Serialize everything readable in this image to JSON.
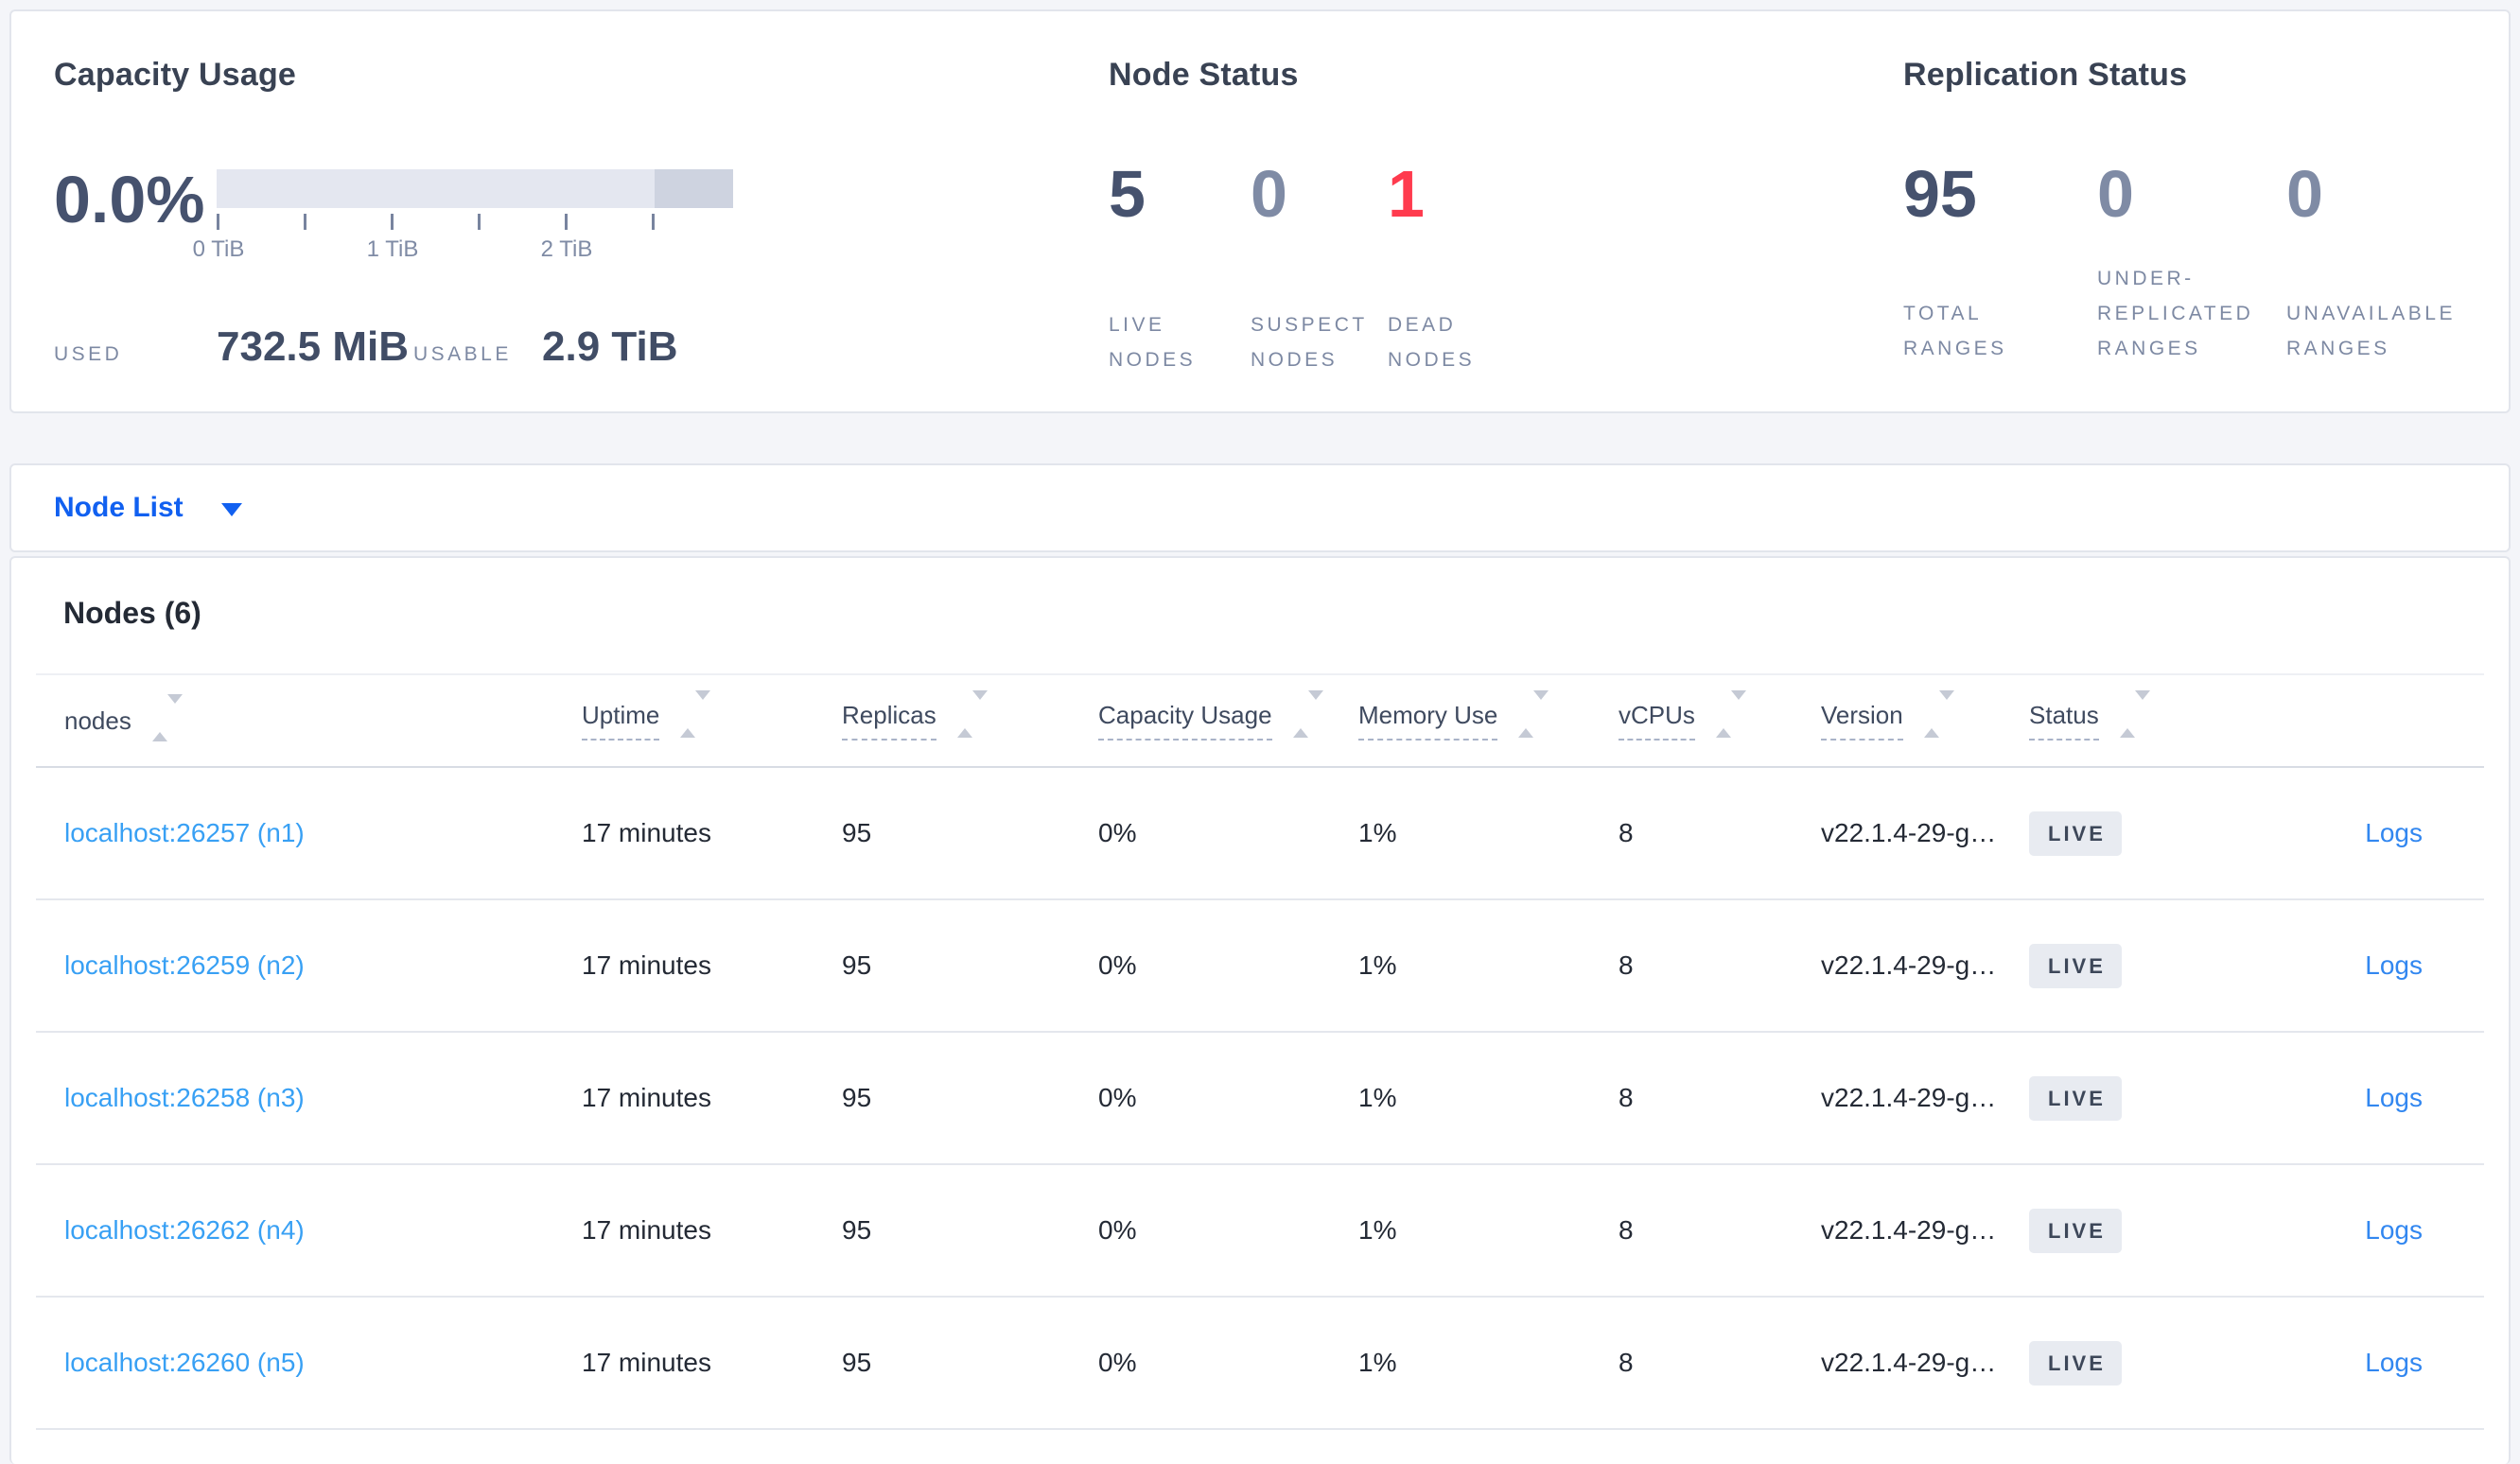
{
  "colors": {
    "accent_blue": "#1160f0",
    "node_link_blue": "#38a0f4",
    "logs_link_blue": "#3287f0",
    "dark_number": "#46526e",
    "muted_number": "#7f8ba5",
    "dead_red": "#ff3b4e",
    "badge_bg": "#e8ebf1",
    "bar_light": "#e4e7f0",
    "bar_dark": "#ced3e0"
  },
  "capacity": {
    "title": "Capacity Usage",
    "percent_used": "0.0%",
    "axis_ticks": [
      "0 TiB",
      "1 TiB",
      "2 TiB"
    ],
    "used_label": "USED",
    "used_value": "732.5 MiB",
    "usable_label": "USABLE",
    "usable_value": "2.9 TiB"
  },
  "node_status": {
    "title": "Node Status",
    "metrics": [
      {
        "value": "5",
        "label": "LIVE NODES"
      },
      {
        "value": "0",
        "label": "SUSPECT NODES"
      },
      {
        "value": "1",
        "label": "DEAD NODES"
      }
    ]
  },
  "replication_status": {
    "title": "Replication Status",
    "metrics": [
      {
        "value": "95",
        "label": "TOTAL RANGES"
      },
      {
        "value": "0",
        "label": "UNDER-REPLICATED RANGES"
      },
      {
        "value": "0",
        "label": "UNAVAILABLE RANGES"
      }
    ]
  },
  "node_list_dropdown": {
    "label": "Node List"
  },
  "nodes_section": {
    "title": "Nodes (6)"
  },
  "table": {
    "columns": [
      {
        "label": "nodes"
      },
      {
        "label": "Uptime"
      },
      {
        "label": "Replicas"
      },
      {
        "label": "Capacity Usage"
      },
      {
        "label": "Memory Use"
      },
      {
        "label": "vCPUs"
      },
      {
        "label": "Version"
      },
      {
        "label": "Status"
      }
    ],
    "logs_label": "Logs",
    "rows": [
      {
        "address": "localhost:26257 (n1)",
        "uptime": "17 minutes",
        "replicas": "95",
        "capacity": "0%",
        "memory": "1%",
        "vcpus": "8",
        "version": "v22.1.4-29-g…",
        "status": "LIVE"
      },
      {
        "address": "localhost:26259 (n2)",
        "uptime": "17 minutes",
        "replicas": "95",
        "capacity": "0%",
        "memory": "1%",
        "vcpus": "8",
        "version": "v22.1.4-29-g…",
        "status": "LIVE"
      },
      {
        "address": "localhost:26258 (n3)",
        "uptime": "17 minutes",
        "replicas": "95",
        "capacity": "0%",
        "memory": "1%",
        "vcpus": "8",
        "version": "v22.1.4-29-g…",
        "status": "LIVE"
      },
      {
        "address": "localhost:26262 (n4)",
        "uptime": "17 minutes",
        "replicas": "95",
        "capacity": "0%",
        "memory": "1%",
        "vcpus": "8",
        "version": "v22.1.4-29-g…",
        "status": "LIVE"
      },
      {
        "address": "localhost:26260 (n5)",
        "uptime": "17 minutes",
        "replicas": "95",
        "capacity": "0%",
        "memory": "1%",
        "vcpus": "8",
        "version": "v22.1.4-29-g…",
        "status": "LIVE"
      }
    ]
  }
}
